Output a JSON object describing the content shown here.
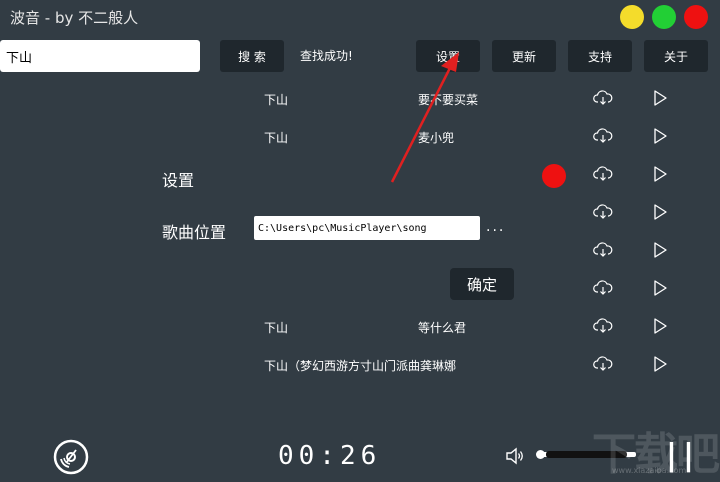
{
  "window": {
    "title": "波音 - by 不二般人",
    "controls": [
      {
        "name": "minimize",
        "color": "#f4dc2b"
      },
      {
        "name": "maximize",
        "color": "#22cf35"
      },
      {
        "name": "close",
        "color": "#ee1111"
      }
    ]
  },
  "search": {
    "value": "下山",
    "button_label": "搜 索",
    "status": "查找成功!"
  },
  "toolbar": {
    "settings_label": "设置",
    "update_label": "更新",
    "support_label": "支持",
    "about_label": "关于"
  },
  "songs": [
    {
      "artist": "下山",
      "title": "要不要买菜"
    },
    {
      "artist": "下山",
      "title": "麦小兜"
    },
    {
      "artist": "",
      "title": ""
    },
    {
      "artist": "",
      "title": ""
    },
    {
      "artist": "",
      "title": ""
    },
    {
      "artist": "",
      "title": ""
    },
    {
      "artist": "下山",
      "title": "等什么君"
    },
    {
      "artist": "下山（梦幻西游方寸山门派曲龚琳娜",
      "title": ""
    }
  ],
  "settings_panel": {
    "heading": "设置",
    "song_location_label": "歌曲位置",
    "song_location_value": "C:\\Users\\pc\\MusicPlayer\\song",
    "browse_label": "...",
    "confirm_label": "确定",
    "indicator_color": "#ee1111"
  },
  "player": {
    "time": "00:26",
    "volume_fraction": 0.9,
    "pause_label": "||"
  },
  "watermark": {
    "text": "下载吧",
    "sub": "www.xiazaiba.com"
  },
  "annotation_color": "#e02020"
}
